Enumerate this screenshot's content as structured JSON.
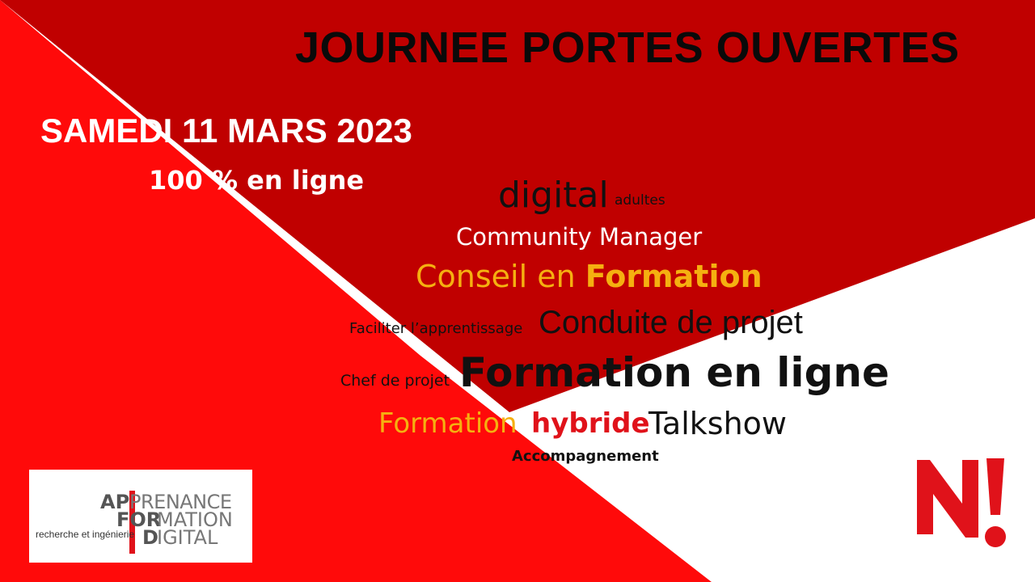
{
  "slide": {
    "title": "JOURNEE PORTES OUVERTES",
    "date": "SAMEDI 11 MARS 2023",
    "mode": "100 % en ligne"
  },
  "word_cloud": {
    "digital": "digital",
    "adultes": "adultes",
    "community_manager": "Community Manager",
    "conseil_en": "Conseil en ",
    "conseil_formation": "Formation",
    "faciliter": "Faciliter l’apprentissage",
    "conduite": "Conduite de projet",
    "chef": "Chef de projet",
    "formation_en_ligne": "Formation en ligne",
    "formation": "Formation ",
    "hybride": "hybride",
    "talkshow": "Talkshow",
    "accompagnement": "Accompagnement"
  },
  "logo": {
    "line1_bold": "AP",
    "line1_light": "PRENANCE",
    "line2_bold": "FOR",
    "line2_light": "MATION",
    "line3_bold": "D",
    "line3_light": "IGITAL",
    "tagline": "recherche et ingénierie"
  },
  "colors": {
    "red_bright": "#ff0a0a",
    "red_dark": "#c00000",
    "yellow": "#f5b010",
    "logo_red": "#e0121a"
  }
}
